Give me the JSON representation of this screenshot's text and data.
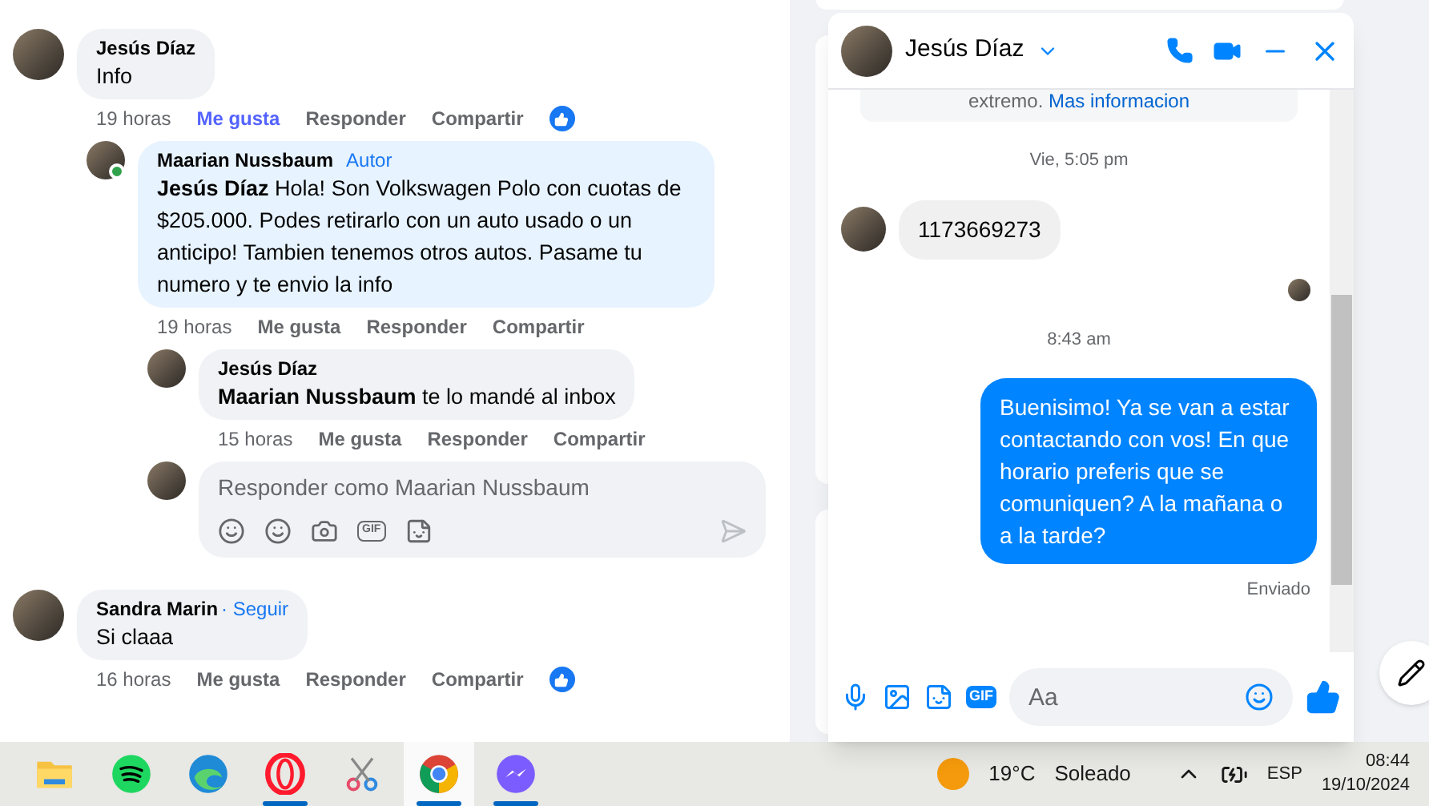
{
  "feed": {
    "comments": [
      {
        "author": "Jesús Díaz",
        "text": "Info",
        "time": "19 horas",
        "actions": [
          {
            "label": "Me gusta",
            "selected": true
          },
          {
            "label": "Responder",
            "selected": false
          },
          {
            "label": "Compartir",
            "selected": false
          }
        ],
        "reacted": true,
        "children": [
          {
            "author": "Maarian Nussbaum",
            "badge": "Autor",
            "online": true,
            "text": "**Jesús Díaz** Hola! Son Volkswagen Polo con cuotas de $205.000. Podes retirarlo con un auto usado o un anticipo! Tambien tenemos otros autos. Pasame tu numero y te envio la info",
            "time": "19 horas",
            "actions": [
              {
                "label": "Me gusta",
                "selected": false
              },
              {
                "label": "Responder",
                "selected": false
              },
              {
                "label": "Compartir",
                "selected": false
              }
            ],
            "reacted": false
          },
          {
            "author": "Jesús Díaz",
            "online": false,
            "text": "**Maarian Nussbaum** te lo mandé al inbox",
            "time": "15 horas",
            "actions": [
              {
                "label": "Me gusta",
                "selected": false
              },
              {
                "label": "Responder",
                "selected": false
              },
              {
                "label": "Compartir",
                "selected": false
              }
            ],
            "reacted": false
          }
        ],
        "reply_box": {
          "placeholder": "Responder como Maarian Nussbaum",
          "gif_label": "GIF"
        }
      },
      {
        "author": "Sandra Marin",
        "follow": "· Seguir",
        "text": "Si claaa",
        "time": "16 horas",
        "actions": [
          {
            "label": "Me gusta",
            "selected": false
          },
          {
            "label": "Responder",
            "selected": false
          },
          {
            "label": "Compartir",
            "selected": false
          }
        ],
        "reacted": true
      }
    ]
  },
  "chat": {
    "title": "Jesús Díaz",
    "notice": "extremo.",
    "notice_link": "Mas informacion",
    "messages": [
      {
        "kind": "time",
        "text": "Vie, 5:05 pm"
      },
      {
        "kind": "incoming",
        "text": "1173669273"
      },
      {
        "kind": "seen"
      },
      {
        "kind": "time",
        "text": "8:43 am"
      },
      {
        "kind": "outgoing",
        "text": "Buenisimo! Ya se van a estar contactando con vos! En que horario preferis que se comuniquen? A la mañana o a la tarde?"
      },
      {
        "kind": "status",
        "text": "Enviado"
      }
    ],
    "input": {
      "placeholder": "Aa"
    },
    "gif_label": "GIF"
  },
  "taskbar": {
    "apps": [
      {
        "kind": "folder",
        "open": false,
        "selected": false
      },
      {
        "kind": "spotify",
        "open": false,
        "selected": false
      },
      {
        "kind": "edge",
        "open": false,
        "selected": false
      },
      {
        "kind": "opera",
        "open": true,
        "selected": false
      },
      {
        "kind": "scissors",
        "open": false,
        "selected": false
      },
      {
        "kind": "chrome",
        "open": true,
        "selected": true
      },
      {
        "kind": "messenger",
        "open": true,
        "selected": false
      }
    ],
    "weather": {
      "temp": "19°C",
      "condition": "Soleado"
    },
    "language": "ESP",
    "time": "08:44",
    "date": "19/10/2024"
  }
}
